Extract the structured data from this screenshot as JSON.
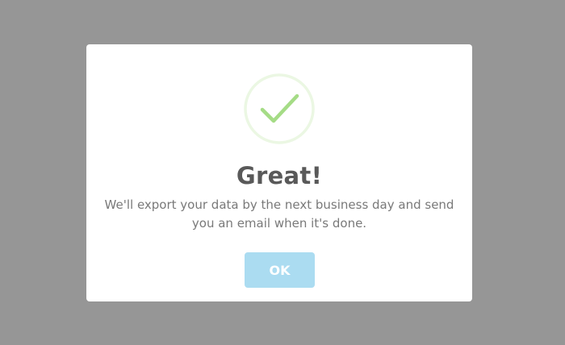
{
  "dialog": {
    "icon": "checkmark-success-icon",
    "title": "Great!",
    "message": "We'll export your data by the next business day and send you an email when it's done.",
    "ok_label": "OK"
  },
  "colors": {
    "overlay": "#969696",
    "modal_background": "#ffffff",
    "success_ring": "#ebf7e3",
    "success_check": "#a5dc86",
    "title_text": "#595959",
    "message_text": "#797979",
    "button_background": "#abdcf1",
    "button_text": "#ffffff"
  }
}
